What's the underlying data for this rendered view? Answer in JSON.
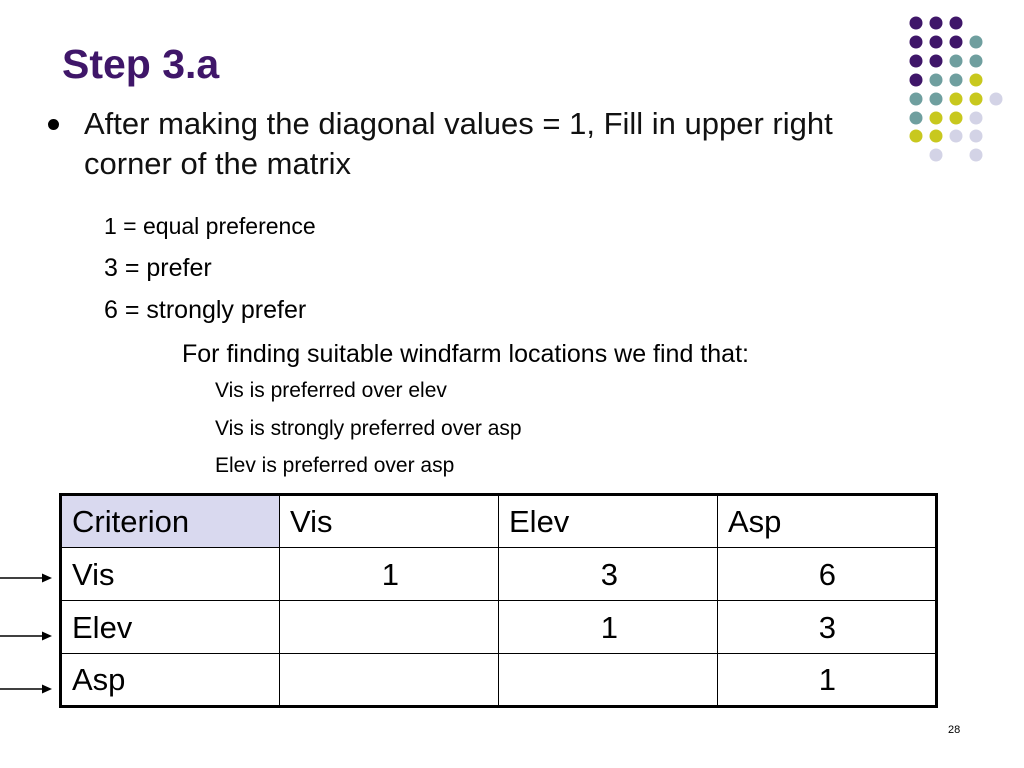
{
  "slide": {
    "title": "Step 3.a",
    "bullet": "After making the diagonal values = 1, Fill in upper right corner of the matrix",
    "lines": [
      "1 = equal preference",
      "3 = prefer",
      "6 = strongly prefer",
      "For finding suitable windfarm locations we find that:",
      "Vis is preferred over elev",
      "Vis is strongly preferred over asp",
      "Elev is preferred over asp"
    ],
    "page_number": "28"
  },
  "matrix": {
    "header": [
      "Criterion",
      "Vis",
      "Elev",
      "Asp"
    ],
    "rows": [
      {
        "label": "Vis",
        "cells": [
          "1",
          "3",
          "6"
        ]
      },
      {
        "label": "Elev",
        "cells": [
          "",
          "1",
          "3"
        ]
      },
      {
        "label": "Asp",
        "cells": [
          "",
          "",
          "1"
        ]
      }
    ]
  },
  "colors": {
    "title": "#3f1669",
    "header_highlight": "#d9d9ef",
    "dot_purple": "#3f1669",
    "dot_teal": "#6f9f9f",
    "dot_yellow": "#c8c81e",
    "dot_lavender": "#d3d3e6"
  }
}
